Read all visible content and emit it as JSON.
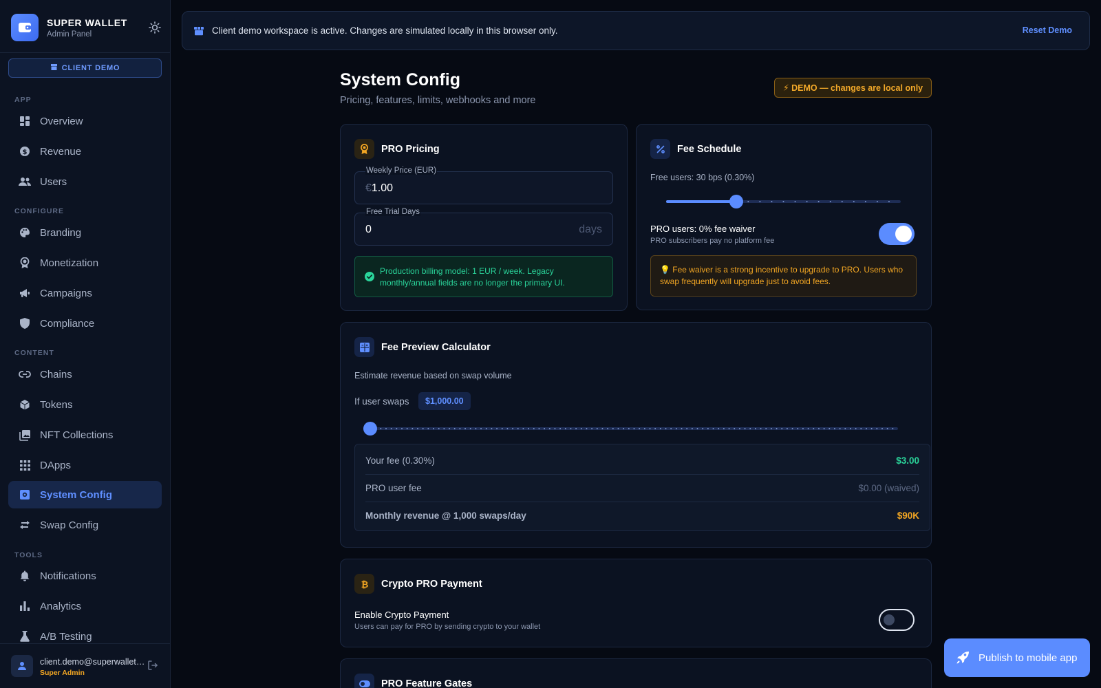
{
  "sidebar": {
    "brand_name": "SUPER WALLET",
    "brand_sub": "Admin Panel",
    "client_demo": "CLIENT DEMO",
    "sections": {
      "app": "APP",
      "configure": "CONFIGURE",
      "content": "CONTENT",
      "tools": "TOOLS"
    },
    "items": {
      "overview": "Overview",
      "revenue": "Revenue",
      "users": "Users",
      "branding": "Branding",
      "monetization": "Monetization",
      "campaigns": "Campaigns",
      "compliance": "Compliance",
      "chains": "Chains",
      "tokens": "Tokens",
      "nft": "NFT Collections",
      "dapps": "DApps",
      "system_config": "System Config",
      "swap_config": "Swap Config",
      "notifications": "Notifications",
      "analytics": "Analytics",
      "ab_testing": "A/B Testing"
    },
    "active_item": "System Config",
    "user": {
      "email": "client.demo@superwallet.app",
      "role": "Super Admin"
    }
  },
  "banner": {
    "text": "Client demo workspace is active. Changes are simulated locally in this browser only.",
    "reset_label": "Reset Demo"
  },
  "header": {
    "title": "System Config",
    "subtitle": "Pricing, features, limits, webhooks and more",
    "demo_badge": "⚡ DEMO — changes are local only"
  },
  "pro_pricing": {
    "title": "PRO Pricing",
    "weekly_price_label": "Weekly Price (EUR)",
    "weekly_price_prefix": "€",
    "weekly_price_value": "1.00",
    "trial_label": "Free Trial Days",
    "trial_value": "0",
    "trial_suffix": "days",
    "billing_note": "Production billing model: 1 EUR / week. Legacy monthly/annual fields are no longer the primary UI."
  },
  "fee_schedule": {
    "title": "Fee Schedule",
    "free_users_label": "Free users: 30 bps (0.30%)",
    "free_users_slider_fraction": 0.3,
    "pro_waiver_title": "PRO users: 0% fee waiver",
    "pro_waiver_sub": "PRO subscribers pay no platform fee",
    "pro_waiver_enabled": true,
    "tip": "💡 Fee waiver is a strong incentive to upgrade to PRO. Users who swap frequently will upgrade just to avoid fees."
  },
  "fee_calculator": {
    "title": "Fee Preview Calculator",
    "description": "Estimate revenue based on swap volume",
    "swap_label": "If user swaps",
    "swap_amount": "$1,000.00",
    "swap_slider_fraction": 0,
    "rows": [
      {
        "label": "Your fee (0.30%)",
        "value": "$3.00",
        "color": "#2ad49a"
      },
      {
        "label": "PRO user fee",
        "value": "$0.00 (waived)",
        "color": "#5d6984"
      },
      {
        "label": "Monthly revenue @ 1,000 swaps/day",
        "value": "$90K",
        "color": "#f2a623"
      }
    ]
  },
  "crypto_payment": {
    "title": "Crypto PRO Payment",
    "enable_title": "Enable Crypto Payment",
    "enable_sub": "Users can pay for PRO by sending crypto to your wallet",
    "enabled": false
  },
  "feature_gates": {
    "title": "PRO Feature Gates"
  },
  "fab": {
    "label": "Publish to mobile app"
  },
  "colors": {
    "accent": "#5b8cff",
    "success": "#2ad49a",
    "warning": "#f2a623",
    "background": "#060a13"
  }
}
